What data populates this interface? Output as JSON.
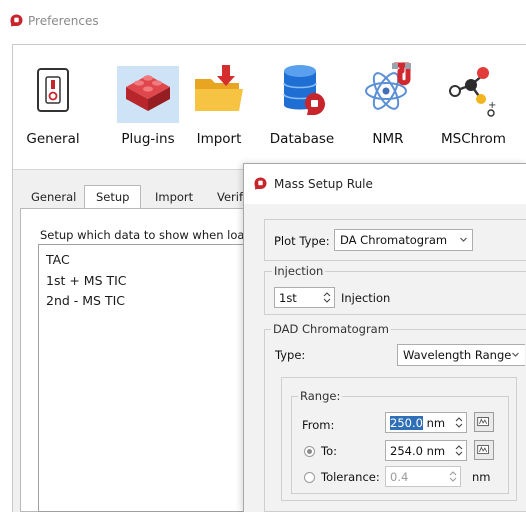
{
  "preferences": {
    "title": "Preferences",
    "toolbar": [
      {
        "label": "General",
        "icon": "switch-icon"
      },
      {
        "label": "Plug-ins",
        "icon": "lego-brick-icon"
      },
      {
        "label": "Import",
        "icon": "folder-import-icon"
      },
      {
        "label": "Database",
        "icon": "database-icon"
      },
      {
        "label": "NMR",
        "icon": "atom-magnet-icon"
      },
      {
        "label": "MSChrom",
        "icon": "molecule-icon"
      }
    ],
    "tabs": [
      "General",
      "Setup",
      "Import",
      "Verify"
    ],
    "setup_description": "Setup which data to show when loading",
    "plot_items": [
      "TAC",
      "1st + MS TIC",
      "2nd - MS TIC"
    ]
  },
  "mass_setup_rule": {
    "title": "Mass Setup Rule",
    "plot_type_label": "Plot Type:",
    "plot_type_value": "DA Chromatogram",
    "injection_group": "Injection",
    "injection_value": "1st",
    "injection_label": "Injection",
    "dad_group": "DAD Chromatogram",
    "type_label": "Type:",
    "type_value": "Wavelength Range",
    "range_group": "Range:",
    "from_label": "From:",
    "from_value": "250.0",
    "from_unit": "nm",
    "to_label": "To:",
    "to_value": "254.0 nm",
    "tolerance_label": "Tolerance:",
    "tolerance_value": "0.4",
    "tolerance_unit": "nm"
  },
  "colors": {
    "accent": "#c8242b",
    "selection": "#2f6fb7",
    "toolbar_highlight": "#cfe3f7"
  }
}
